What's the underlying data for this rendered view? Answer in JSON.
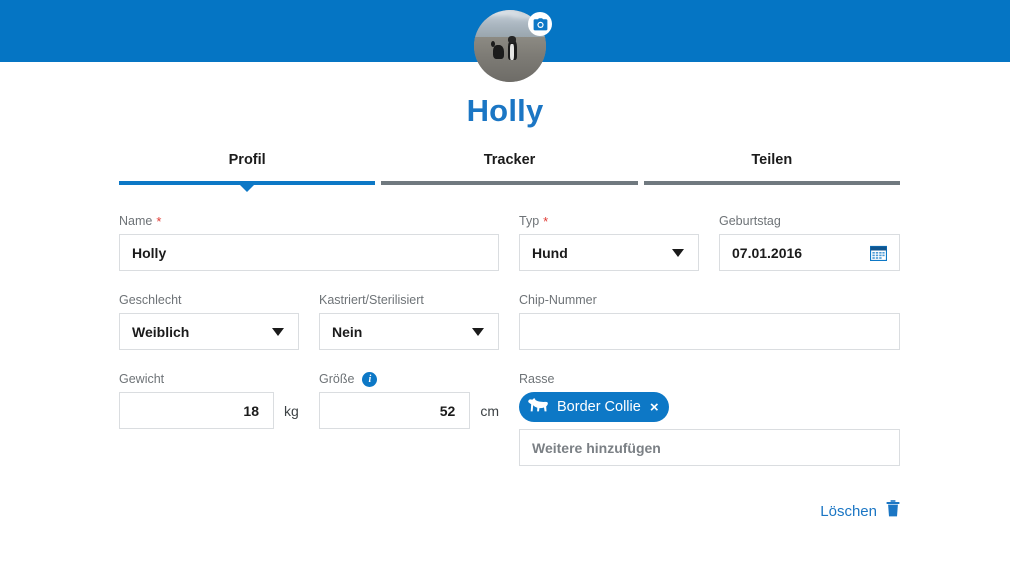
{
  "theme": {
    "header_blue": "#0575c4",
    "accent_blue": "#0d78c6",
    "title_blue": "#1b76c4",
    "tab_inactive": "#70797f",
    "required_red": "#e03b34",
    "border_gray": "#dadde0",
    "label_gray": "#6e7377"
  },
  "header": {
    "avatar_alt": "border-collie-photo",
    "camera_icon": "camera-icon"
  },
  "pet": {
    "name_title": "Holly"
  },
  "tabs": [
    {
      "label": "Profil",
      "active": true
    },
    {
      "label": "Tracker",
      "active": false
    },
    {
      "label": "Teilen",
      "active": false
    }
  ],
  "form": {
    "name": {
      "label": "Name",
      "required": "*",
      "value": "Holly",
      "placeholder": ""
    },
    "typ": {
      "label": "Typ",
      "required": "*",
      "value": "Hund",
      "options": [
        "Hund"
      ]
    },
    "geburtstag": {
      "label": "Geburtstag",
      "value": "07.01.2016",
      "icon": "calendar-icon"
    },
    "geschlecht": {
      "label": "Geschlecht",
      "value": "Weiblich",
      "options": [
        "Weiblich"
      ]
    },
    "kastriert": {
      "label": "Kastriert/Sterilisiert",
      "value": "Nein",
      "options": [
        "Nein"
      ]
    },
    "chip_nummer": {
      "label": "Chip-Nummer",
      "value": "",
      "placeholder": ""
    },
    "gewicht": {
      "label": "Gewicht",
      "value": "18",
      "unit": "kg"
    },
    "groesse": {
      "label": "Größe",
      "value": "52",
      "unit": "cm",
      "info_icon": "info-icon"
    },
    "rasse": {
      "label": "Rasse",
      "chips": [
        {
          "label": "Border Collie",
          "icon": "dog-icon",
          "close": "×"
        }
      ],
      "add_placeholder": "Weitere hinzufügen"
    }
  },
  "actions": {
    "delete_label": "Löschen",
    "delete_icon": "trash-icon"
  }
}
